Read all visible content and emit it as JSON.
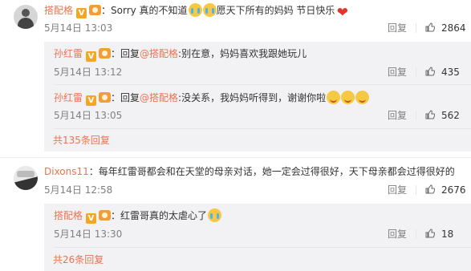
{
  "comments": [
    {
      "user": "搭配格",
      "text": "：Sorry 真的不知道",
      "text2": "愿天下所有的妈妈 节日快乐",
      "time": "5月14日 13:03",
      "reply": "回复",
      "likes": "2864",
      "replies": [
        {
          "user": "孙红雷",
          "prefix": "：回复",
          "mention": "@搭配格",
          "text": ":别在意，妈妈喜欢我跟她玩儿",
          "time": "5月14日 13:12",
          "reply": "回复",
          "likes": "435"
        },
        {
          "user": "孙红雷",
          "prefix": "：回复",
          "mention": "@搭配格",
          "text": ":没关系，我妈妈听得到，谢谢你啦",
          "time": "5月14日 13:05",
          "reply": "回复",
          "likes": "562"
        }
      ],
      "more_replies": "共135条回复"
    },
    {
      "user": "Dixons11",
      "text": "：每年红雷哥都会和在天堂的母亲对话，她一定会过得很好，天下母亲都会过得很好的",
      "time": "5月14日 12:58",
      "reply": "回复",
      "likes": "2676",
      "replies": [
        {
          "user": "搭配格",
          "text": "：红雷哥真的太虐心了",
          "time": "5月14日 13:30",
          "reply": "回复",
          "likes": "18"
        }
      ],
      "more_replies": "共26条回复"
    }
  ],
  "icons": {
    "verified": "V",
    "heart": "❤"
  },
  "colors": {
    "name": "#eb7350",
    "meta": "#808080",
    "subpanel_bg": "#f2f2f5"
  }
}
